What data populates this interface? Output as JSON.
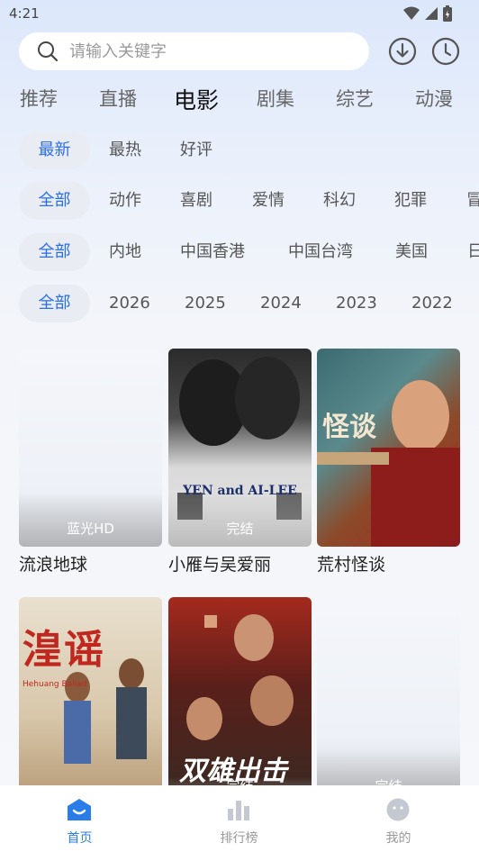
{
  "status_bar": {
    "time": "4:21"
  },
  "search": {
    "placeholder": "请输入关键字"
  },
  "main_tabs": [
    {
      "label": "推荐"
    },
    {
      "label": "直播"
    },
    {
      "label": "电影"
    },
    {
      "label": "剧集"
    },
    {
      "label": "综艺"
    },
    {
      "label": "动漫"
    }
  ],
  "active_tab": "电影",
  "filters": {
    "sort": [
      "最新",
      "最热",
      "好评"
    ],
    "genre": [
      "全部",
      "动作",
      "喜剧",
      "爱情",
      "科幻",
      "犯罪",
      "冒"
    ],
    "region": [
      "全部",
      "内地",
      "中国香港",
      "中国台湾",
      "美国",
      "日"
    ],
    "year": [
      "全部",
      "2026",
      "2025",
      "2024",
      "2023",
      "2022"
    ]
  },
  "movies": [
    {
      "title": "流浪地球",
      "badge": "蓝光HD"
    },
    {
      "title": "小雁与吴爱丽",
      "badge": "完结",
      "poster_text": "YEN and AI-LEE"
    },
    {
      "title": "荒村怪谈",
      "badge": "",
      "poster_text": "怪谈"
    },
    {
      "title": "",
      "badge": "",
      "poster_text": "湟谣",
      "poster_subtext": "Hehuang Ballad"
    },
    {
      "title": "",
      "badge": "完结",
      "poster_text": "双雄出击"
    },
    {
      "title": "",
      "badge": "完结"
    }
  ],
  "bottom_nav": [
    {
      "label": "首页",
      "icon": "home-icon"
    },
    {
      "label": "排行榜",
      "icon": "ranking-icon"
    },
    {
      "label": "我的",
      "icon": "profile-icon"
    }
  ],
  "colors": {
    "accent": "#2a6fe8",
    "nav_active": "#2a7de8"
  }
}
